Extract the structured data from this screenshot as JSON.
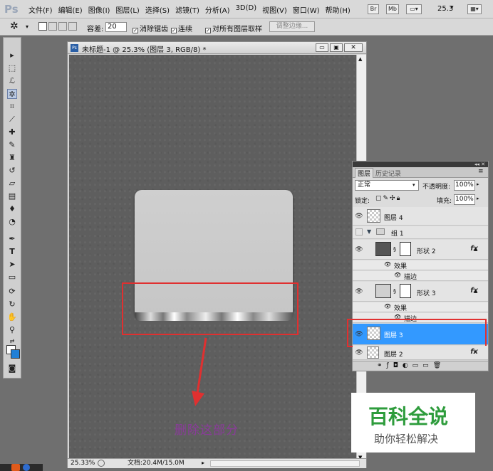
{
  "menubar": {
    "logo": "Ps",
    "menus": [
      "文件(F)",
      "编辑(E)",
      "图像(I)",
      "图层(L)",
      "选择(S)",
      "滤镜(T)",
      "分析(A)",
      "3D(D)",
      "视图(V)",
      "窗口(W)",
      "帮助(H)"
    ],
    "btn_br": "Br",
    "btn_mb": "Mb",
    "zoom": "25.3"
  },
  "options": {
    "tolerance_label": "容差:",
    "tolerance_value": "20",
    "antialias": "消除锯齿",
    "contiguous": "连续",
    "all_layers": "对所有图层取样",
    "refine_edge": "调整边缘..."
  },
  "document": {
    "title": "未标题-1 @ 25.3% (图层 3, RGB/8) *",
    "status_zoom": "25.33%",
    "status_doc": "文档:20.4M/15.0M"
  },
  "annotation": {
    "text": "删除这部分",
    "color": "#8a3b9a",
    "box_color": "#e03030"
  },
  "layers_panel": {
    "tab_layers": "图层",
    "tab_history": "历史记录",
    "blend_mode": "正常",
    "opacity_label": "不透明度:",
    "opacity_value": "100%",
    "lock_label": "锁定:",
    "fill_label": "填充:",
    "fill_value": "100%",
    "layers": [
      {
        "name": "图层 4"
      },
      {
        "name": "组 1"
      },
      {
        "name": "形状 2",
        "effects": "效果",
        "stroke": "描边"
      },
      {
        "name": "形状 3",
        "effects": "效果",
        "stroke": "描边"
      },
      {
        "name": "图层 3"
      },
      {
        "name": "图层 2"
      }
    ],
    "selected_color": "#3399ff",
    "fx": "fx"
  },
  "watermark": {
    "title": "百科全说",
    "subtitle": "助你轻松解决",
    "title_color": "#2e9c3c"
  }
}
